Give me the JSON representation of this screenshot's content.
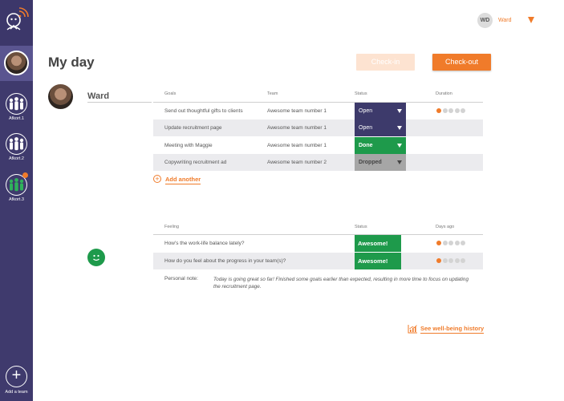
{
  "user": {
    "initials": "WD",
    "name": "Ward"
  },
  "page": {
    "title": "My day",
    "checkin_label": "Check-in",
    "checkout_label": "Check-out"
  },
  "sidebar": {
    "teams": [
      {
        "label": "Afkort.1",
        "has_notification": false
      },
      {
        "label": "Afkort.2",
        "has_notification": false
      },
      {
        "label": "Afkort.3",
        "has_notification": true
      }
    ],
    "add_team_label": "Add a team"
  },
  "person": {
    "name": "Ward"
  },
  "goals": {
    "headers": {
      "goals": "Goals",
      "team": "Team",
      "status": "Status",
      "duration": "Duration"
    },
    "rows": [
      {
        "goal": "Send out thoughtful gifts to clients",
        "team": "Awesome team number 1",
        "status": "Open",
        "duration": 1
      },
      {
        "goal": "Update recruitment page",
        "team": "Awesome team number 1",
        "status": "Open",
        "duration": null
      },
      {
        "goal": "Meeting with Maggie",
        "team": "Awesome team number 1",
        "status": "Done",
        "duration": null
      },
      {
        "goal": "Copywriting recruitment ad",
        "team": "Awesome team number 2",
        "status": "Dropped",
        "duration": null
      }
    ],
    "add_another_label": "Add another"
  },
  "feelings": {
    "headers": {
      "feeling": "Feeling",
      "status": "Status",
      "days_ago": "Days ago"
    },
    "rows": [
      {
        "question": "How's the work-life balance lately?",
        "status": "Awesome!",
        "days_ago": 1
      },
      {
        "question": "How do you feel about the progress in your team(s)?",
        "status": "Awesome!",
        "days_ago": 1
      }
    ],
    "note_label": "Personal note:",
    "note_text": "Today is going great so far! Finished some goals earlier than expected, resulting in more time to focus on updating the recruitment page."
  },
  "history_label": "See well-being history",
  "colors": {
    "accent": "#f07b2a",
    "sidebar": "#3f3a6d",
    "open": "#3d3a6b",
    "done": "#1e9a4b",
    "dropped": "#a6a6a6"
  }
}
